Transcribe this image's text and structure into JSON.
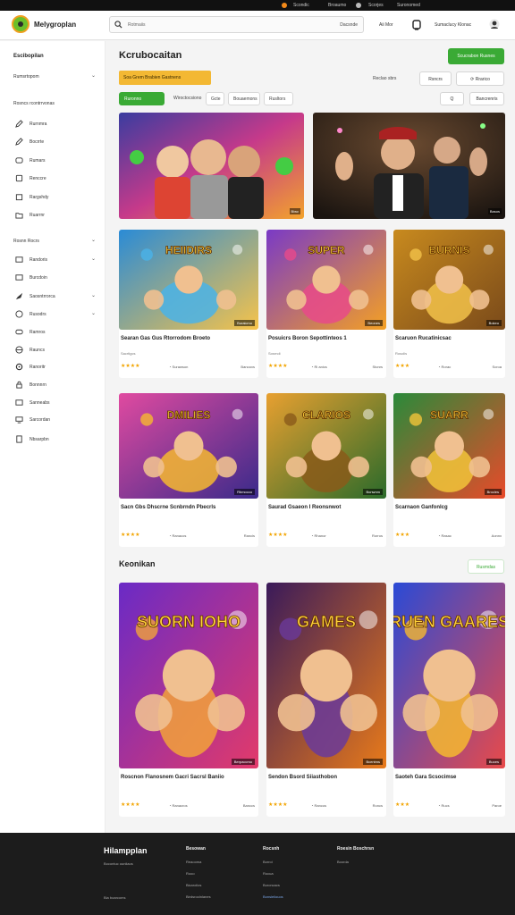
{
  "topbar": {
    "a": "Scondic",
    "b": "Broaumo",
    "c": "Scorjes",
    "d": "Suronomed"
  },
  "header": {
    "brand": "Melygroplan",
    "search_placeholder": "Rotmaiis",
    "search_button": "Dacsnde",
    "link_1": "Aii Mor",
    "link_2": "Sumaclucy Klonac"
  },
  "sidebar": {
    "head": "Escibopilan",
    "group_1": {
      "label": "Rumsrtopom",
      "items": [
        "Rurnmra",
        "Bocrrte",
        "Rumars",
        "Renccre",
        "Rargshdy",
        "Ruarrnr"
      ]
    },
    "intro": "Rosncs rcontrrvonas",
    "group_2": {
      "label": "Rosnn Rocrs",
      "items": [
        "Randoris",
        "Burcdoin",
        "Saosntrrorca",
        "Rusodrs",
        "Ramros",
        "Rauncs",
        "Ranoritr",
        "Bonnnrn",
        "Sanneabs",
        "Sarcordan",
        "Nbsarpbn"
      ]
    }
  },
  "main": {
    "title": "Kcrubocaitan",
    "add_button": "Scucrabon Rusnes",
    "banner": "Soa Grem Brabien Gastnens",
    "sort_label": "Reclao sbrs",
    "filter_1": "Rsncrs",
    "filter_2": "Rrarico",
    "chips": [
      "Ruronno",
      "Wiroctocsiono",
      "Gcte",
      "Bouaemons",
      "Rusltors"
    ],
    "tool_search": "Q",
    "tool_settings": "Bancrenris",
    "hero_badges": [
      "Biwc",
      "Basos"
    ]
  },
  "cards_row1": [
    {
      "title": "Searan Gas Gus Rtorrodom Broeto",
      "sub": "Sacrtigcs",
      "stars": "★★★★",
      "meta": "Surawson",
      "metaR": "Banooxs",
      "badge": "Buraicmo",
      "art": "HEIIDIRS"
    },
    {
      "title": "Posuicrs Boron Sepottinteos 1",
      "sub": "Sosrndi",
      "stars": "★★★★",
      "meta": "Ri anics",
      "metaR": "Stonrs",
      "badge": "Beones",
      "art": "SUPER"
    },
    {
      "title": "Scaruon Rucatinicsac",
      "sub": "Rosolis",
      "stars": "★★★",
      "meta": "Rorac",
      "metaR": "Scroa",
      "badge": "Bokeo",
      "art": "BURNIS"
    }
  ],
  "cards_row2": [
    {
      "title": "Sacn Gbs Dhscrne Scnbrndn Pbecrls",
      "sub": "",
      "stars": "★★★★",
      "meta": "Ranacos",
      "metaR": "Rancis",
      "badge": "Rbmocco",
      "art": "DMILIES"
    },
    {
      "title": "Saurad Gsaeon I Reonsnwot",
      "sub": "",
      "stars": "★★★★",
      "meta": "Rhanor",
      "metaR": "Rorros",
      "badge": "Bonwnm",
      "art": "CLARIOS"
    },
    {
      "title": "Scarnaon Ganfonlcg",
      "sub": "",
      "stars": "★★★",
      "meta": "Rasac",
      "metaR": "Aonnx",
      "badge": "Brocles",
      "art": "SUARR"
    }
  ],
  "section_2": {
    "title": "Keonikan",
    "button": "Rusmdas"
  },
  "cards_row3": [
    {
      "title": "Roscnon Flanosnem Gacri Sacrsl Baniio",
      "sub": "",
      "stars": "★★★★",
      "meta": "Ranacros",
      "metaR": "Banccs",
      "badge": "Berpaccmo",
      "art": "SUORN IOHO"
    },
    {
      "title": "Sendon Bsord Siiasthobon",
      "sub": "",
      "stars": "★★★★",
      "meta": "Rancos",
      "metaR": "Roncs",
      "badge": "Bcentms",
      "art": "GAMES"
    },
    {
      "title": "Saoteh Gara Scsocimse",
      "sub": "",
      "stars": "★★★",
      "meta": "Rucs",
      "metaR": "Paroe",
      "badge": "Buces",
      "art": "RUEN GAARES"
    }
  ],
  "footer": {
    "brand": "Hilampplan",
    "tagline": "Bocontuc ouniiaos",
    "copyright": "Bia boarcoms",
    "cols": [
      {
        "head": "Besowan",
        "links": [
          "Reaooma",
          "Rooo",
          "Bicaroiios",
          "Birdsroolnlanes"
        ]
      },
      {
        "head": "Rocsnh",
        "links": [
          "Borroi",
          "Rocua",
          "Boroncacs",
          "Bonsieiiouos"
        ]
      },
      {
        "head": "Roesin Boschrsn",
        "links": [
          "Boorda"
        ]
      }
    ]
  }
}
